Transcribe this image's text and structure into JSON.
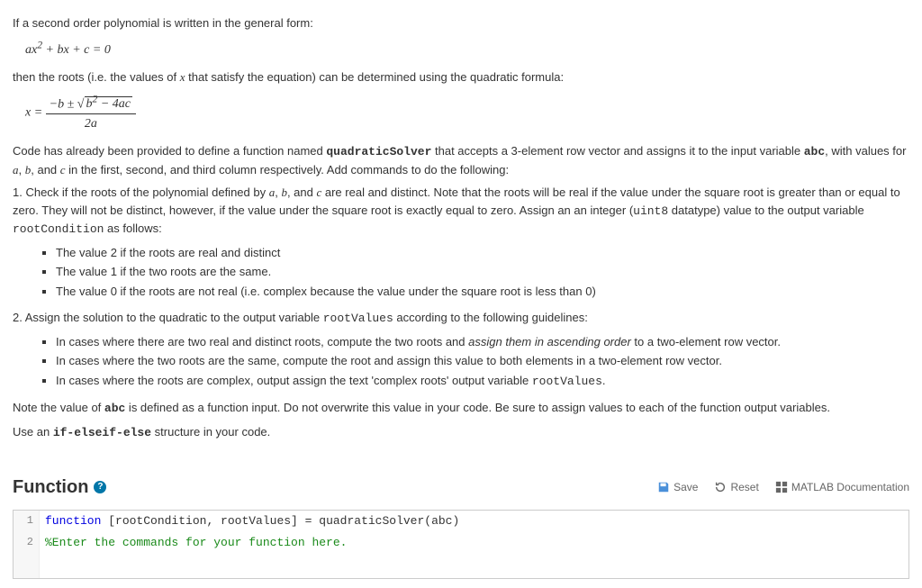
{
  "intro": {
    "p1": "If a second order polynomial is written in the general form:",
    "eq1_html": "ax<sup>2</sup> + bx + c = 0",
    "p2_pre": "then the roots (i.e. the values of ",
    "p2_var": "x",
    "p2_post": " that satisfy the equation) can be determined using the quadratic formula:"
  },
  "quad_formula": {
    "lhs": "x = ",
    "numerator_html": "−b ± <span class=\"sqrt\">√&nbsp;b<sup>2</sup> − 4ac</span>",
    "denominator": "2a"
  },
  "body": {
    "p1_a": "Code has already been provided to define a function named ",
    "p1_fn": "quadraticSolver",
    "p1_b": " that accepts a 3-element row vector and assigns it to the input variable ",
    "p1_abc": "abc",
    "p1_c": ", with values for ",
    "var_a": "a",
    "sep1": ", ",
    "var_b": "b",
    "sep2": ", and ",
    "var_c": "c",
    "p1_d": " in the first, second, and third column respectively.  Add commands to do the following:",
    "q1_a": "1. Check if the roots of the polynomial defined by ",
    "q1_mid1": ", ",
    "q1_mid2": ", and ",
    "q1_b": " are real and distinct. Note that the roots will be real if the value under the square root is greater than or equal to zero. They will not be distinct, however, if the value under the square root is exactly equal to zero. Assign an an integer (",
    "uint8": "uint8",
    "q1_c": " datatype) value to the output variable ",
    "rootCondition": "rootCondition",
    "q1_d": " as follows:",
    "bullets1": [
      "The value 2 if the roots are real and distinct",
      "The value 1 if the two roots are the same.",
      "The value 0 if the roots are not real (i.e. complex because the value under the square root is less than 0)"
    ],
    "q2_a": "2. Assign the solution to the quadratic to the output variable ",
    "rootValues": "rootValues",
    "q2_b": " according to the following guidelines:",
    "b2_1_a": "In cases where there are two real and distinct roots, compute the two roots and ",
    "b2_1_em": "assign them in ascending order",
    "b2_1_b": " to a two-element row vector.",
    "b2_2": "In cases where the two roots are the same, compute the root and assign this value to both elements in a two-element row vector.",
    "b2_3_a": "In cases where the roots are complex, output assign the text 'complex roots' output variable ",
    "b2_3_b": ".",
    "note_a": "Note the value of ",
    "note_b": " is defined as a function input. Do not overwrite this value in your code. Be sure to assign values to each of the function output variables.",
    "use_a": "Use an ",
    "use_code": "if-elseif-else",
    "use_b": " structure in your code."
  },
  "section": {
    "title": "Function",
    "help": "?",
    "save": "Save",
    "reset": "Reset",
    "doc": "MATLAB Documentation"
  },
  "editor": {
    "lines": [
      {
        "n": "1",
        "kw": "function",
        "rest": " [rootCondition, rootValues] = quadraticSolver(abc)"
      },
      {
        "n": "2",
        "comment": "%Enter the commands for your function here."
      }
    ]
  }
}
